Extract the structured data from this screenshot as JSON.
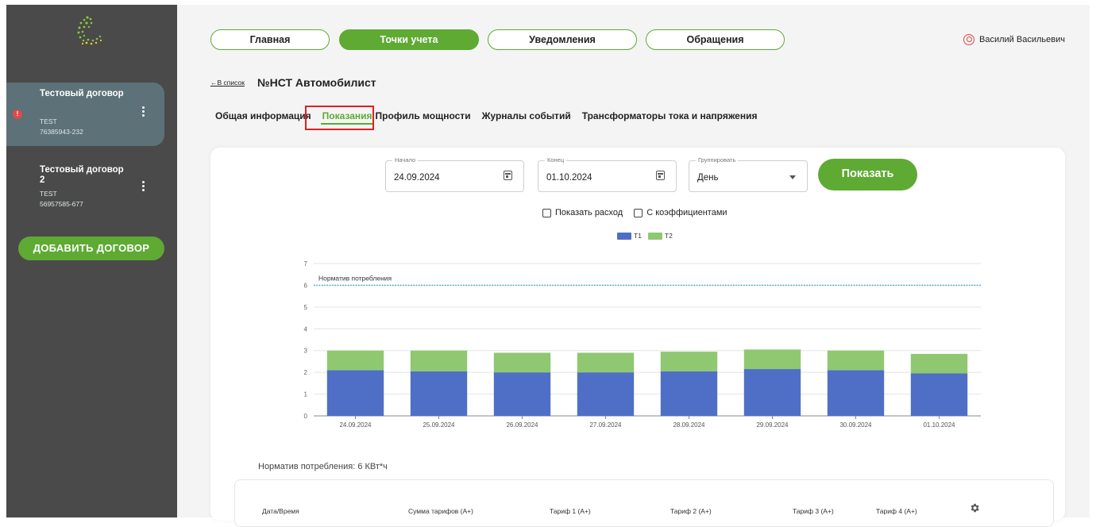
{
  "sidebar": {
    "contracts": [
      {
        "name": "Тестовый договор",
        "type": "TEST",
        "code": "76385943-232",
        "alert": "!"
      },
      {
        "name": "Тестовый договор 2",
        "type": "TEST",
        "code": "56957585-677"
      }
    ],
    "add_button": "ДОБАВИТЬ ДОГОВОР"
  },
  "nav": {
    "items": [
      "Главная",
      "Точки учета",
      "Уведомления",
      "Обращения"
    ],
    "active": "Точки учета"
  },
  "user": {
    "name": "Василий Васильевич"
  },
  "header": {
    "back": "←В список",
    "title": "№НСТ Автомобилист"
  },
  "tabs": [
    "Общая информация",
    "Показания",
    "Профиль мощности",
    "Журналы событий",
    "Трансформаторы тока и напряжения"
  ],
  "filters": {
    "start": {
      "label": "Начало",
      "value": "24.09.2024"
    },
    "end": {
      "label": "Конец",
      "value": "01.10.2024"
    },
    "group": {
      "label": "Группировать",
      "value": "День"
    },
    "show_button": "Показать",
    "checkboxes": [
      "Показать расход",
      "С коэффициентами"
    ]
  },
  "colors": {
    "accent": "#5eaa33",
    "t1": "#4f6fc6",
    "t2": "#8fc871",
    "norm": "#28a0c8"
  },
  "chart_data": {
    "type": "bar",
    "stacked": true,
    "categories": [
      "24.09.2024",
      "25.09.2024",
      "26.09.2024",
      "27.09.2024",
      "28.09.2024",
      "29.09.2024",
      "30.09.2024",
      "01.10.2024"
    ],
    "series": [
      {
        "name": "T1",
        "values": [
          2.1,
          2.05,
          2.0,
          2.0,
          2.05,
          2.15,
          2.1,
          1.95
        ]
      },
      {
        "name": "T2",
        "values": [
          0.9,
          0.95,
          0.9,
          0.9,
          0.9,
          0.9,
          0.9,
          0.9
        ]
      }
    ],
    "ylim": [
      0,
      7
    ],
    "yticks": [
      "0",
      "1",
      "2",
      "3",
      "4",
      "5",
      "6",
      "7"
    ],
    "reference_line": {
      "label": "Норматив потребления",
      "value": 6
    },
    "legend": [
      "T1",
      "T2"
    ],
    "legend_position": "top-center"
  },
  "norm_note": "Норматив потребления: 6 КВт*ч",
  "table": {
    "columns": [
      "Дата/Время",
      "Сумма тарифов (А+)",
      "Тариф 1 (А+)",
      "Тариф 2 (А+)",
      "Тариф 3 (А+)",
      "Тариф 4 (А+)"
    ]
  }
}
